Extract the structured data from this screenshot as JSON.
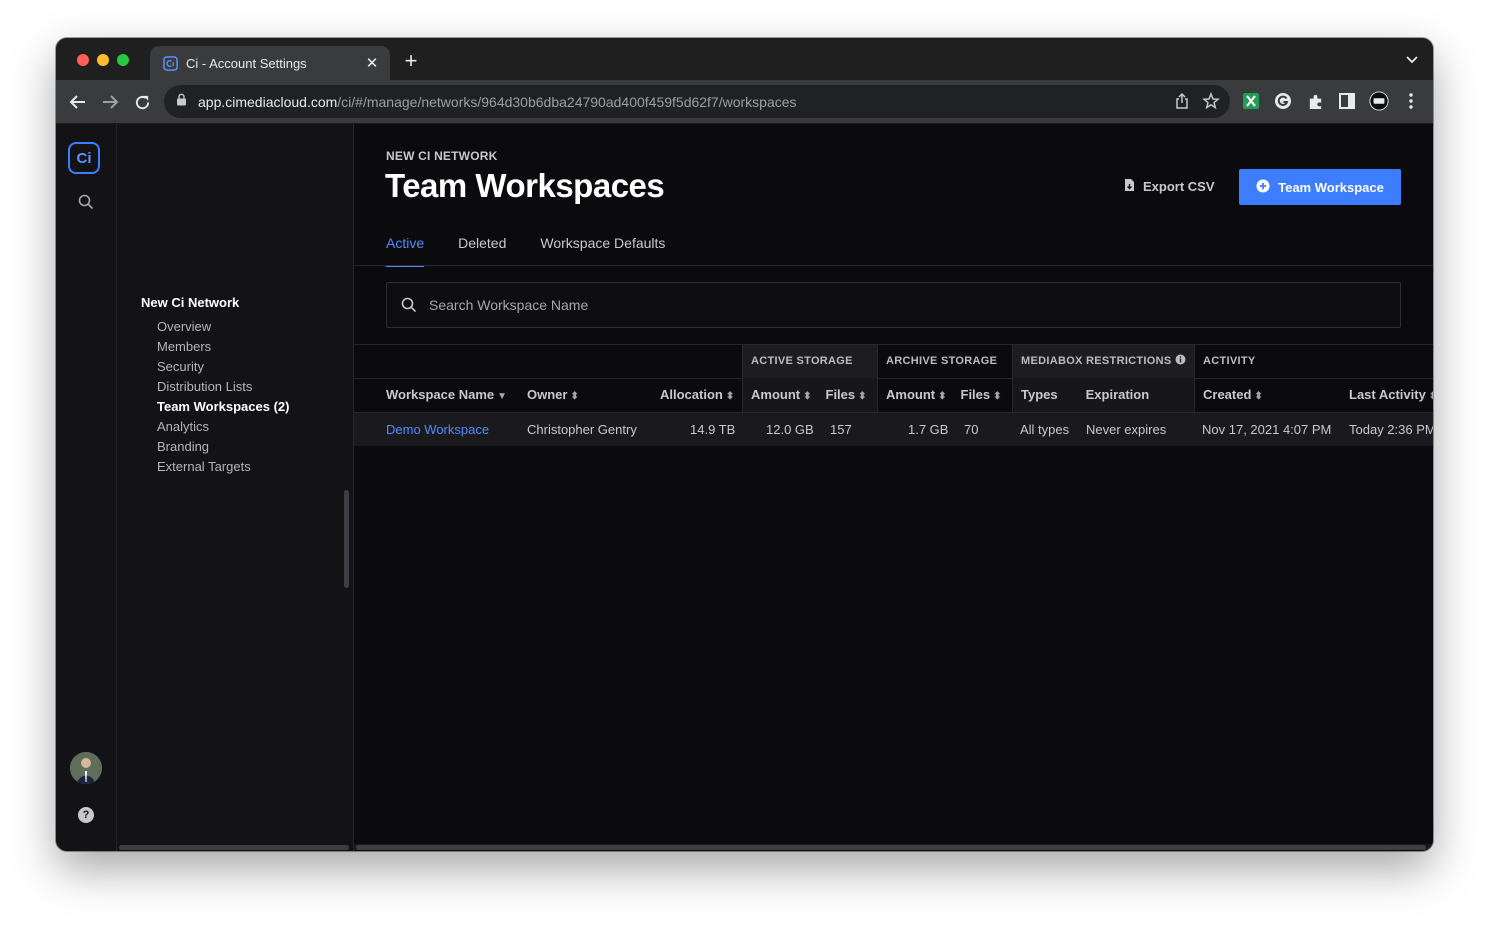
{
  "browser": {
    "tab_title": "Ci - Account Settings",
    "url_host": "app.cimediacloud.com",
    "url_path": "/ci/#/manage/networks/964d30b6dba24790ad400f459f5d62f7/workspaces"
  },
  "app": {
    "logo_text": "Ci",
    "help_label": "?"
  },
  "sidebar": {
    "network_title": "New Ci Network",
    "items": [
      {
        "label": "Overview"
      },
      {
        "label": "Members"
      },
      {
        "label": "Security"
      },
      {
        "label": "Distribution Lists"
      },
      {
        "label": "Team Workspaces (2)",
        "active": true
      },
      {
        "label": "Analytics"
      },
      {
        "label": "Branding"
      },
      {
        "label": "External Targets"
      }
    ]
  },
  "page": {
    "eyebrow": "NEW CI NETWORK",
    "title": "Team Workspaces",
    "export_label": "Export CSV",
    "add_label": "Team Workspace",
    "tabs": [
      {
        "label": "Active",
        "active": true
      },
      {
        "label": "Deleted"
      },
      {
        "label": "Workspace Defaults"
      }
    ],
    "search_placeholder": "Search Workspace Name"
  },
  "table": {
    "groups": {
      "active_storage": "ACTIVE STORAGE",
      "archive_storage": "ARCHIVE STORAGE",
      "mediabox": "MEDIABOX RESTRICTIONS",
      "activity": "ACTIVITY"
    },
    "columns": {
      "name": "Workspace Name",
      "owner": "Owner",
      "allocation": "Allocation",
      "active_amount": "Amount",
      "active_files": "Files",
      "archive_amount": "Amount",
      "archive_files": "Files",
      "types": "Types",
      "expiration": "Expiration",
      "created": "Created",
      "last_activity": "Last Activity"
    },
    "rows": [
      {
        "name": "Demo Workspace",
        "owner": "Christopher Gentry",
        "allocation": "14.9 TB",
        "active_amount": "12.0 GB",
        "active_files": "157",
        "archive_amount": "1.7 GB",
        "archive_files": "70",
        "types": "All types",
        "expiration": "Never expires",
        "created": "Nov 17, 2021 4:07 PM",
        "last_activity": "Today 2:36 PM"
      }
    ]
  },
  "colors": {
    "accent": "#3d7dff",
    "link": "#4f8cff",
    "background": "#0b0b0e"
  }
}
